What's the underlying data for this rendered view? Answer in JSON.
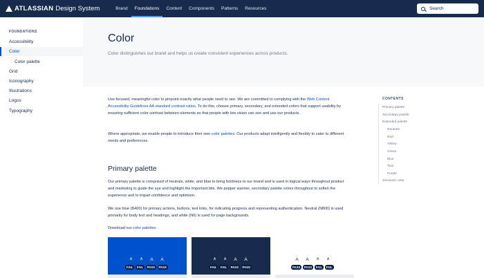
{
  "topnav": {
    "brand": "ATLASSIAN",
    "product": "Design System",
    "links": [
      "Brand",
      "Foundations",
      "Content",
      "Components",
      "Patterns",
      "Resources"
    ],
    "search_label": "Search"
  },
  "sidebar": {
    "heading": "FOUNDATIONS",
    "items": [
      "Accessibility",
      "Color",
      "Color palette",
      "Grid",
      "Iconography",
      "Illustrations",
      "Logos",
      "Typography"
    ]
  },
  "hero": {
    "title": "Color",
    "lead": "Color distinguishes our brand and helps us create consistent experiences across products."
  },
  "content": {
    "p1_a": "Use focused, meaningful color to pinpoint exactly what people need to see. We are committed to complying with the ",
    "p1_link": "Web Content Accessibility Guidelines AA standard contrast ratios",
    "p1_b": ". To do this, choose primary, secondary, and extended colors that support usability by ensuring sufficient color contrast between elements so that people with low vision can see and use our products.",
    "p2_a": "Where appropriate, we enable people to introduce their own ",
    "p2_link": "color palettes",
    "p2_b": ". Our products adapt intelligently and flexibly to cater to different needs and preferences.",
    "h2": "Primary palette",
    "p3": "Our primary palette is comprised of neutrals, white, and blue to bring boldness to our brand and is used in logical ways throughout product and marketing to guide the eye and highlight the important bits. We pepper warmer, secondary palette colors throughout to soften the experience and to impart confidence and optimism.",
    "p4": "We use blue (B400) for primary actions, buttons, text links, for indicating progress and representing authentication. Neutral (N800) is used primarily for body text and headings, and white (N0) is used for page backgrounds.",
    "p5_a": "Download our ",
    "p5_link": "color palettes",
    "p5_b": "."
  },
  "swatches": [
    {
      "color": "#0052CC",
      "glyphs": [
        "A",
        "A",
        "A",
        "A"
      ],
      "badges": [
        "FAIL",
        "FAIL",
        "PASS",
        "PASS"
      ]
    },
    {
      "color": "#172B4D",
      "glyphs": [
        "A",
        "A",
        "A",
        "A"
      ],
      "badges": [
        "FAIL",
        "FAIL",
        "PASS",
        "PASS"
      ]
    },
    {
      "color": "#FFFFFF",
      "glyphs": [
        "A",
        "A",
        "A",
        "A"
      ],
      "badges": [
        "PASS",
        "PASS",
        "FAIL",
        "FAIL"
      ]
    }
  ],
  "toc": {
    "heading": "CONTENTS",
    "items": [
      "Primary palette",
      "Secondary palette",
      "Extended palette",
      "Neutrals",
      "Red",
      "Yellow",
      "Green",
      "Blue",
      "Teal",
      "Purple",
      "Semantic color"
    ]
  },
  "colors": {
    "nav_bg": "#172B4D",
    "link": "#0052CC",
    "hero_bg": "#F7F8F9",
    "blue_b400": "#0052CC",
    "neutral_n800": "#172B4D",
    "white_n0": "#FFFFFF"
  }
}
